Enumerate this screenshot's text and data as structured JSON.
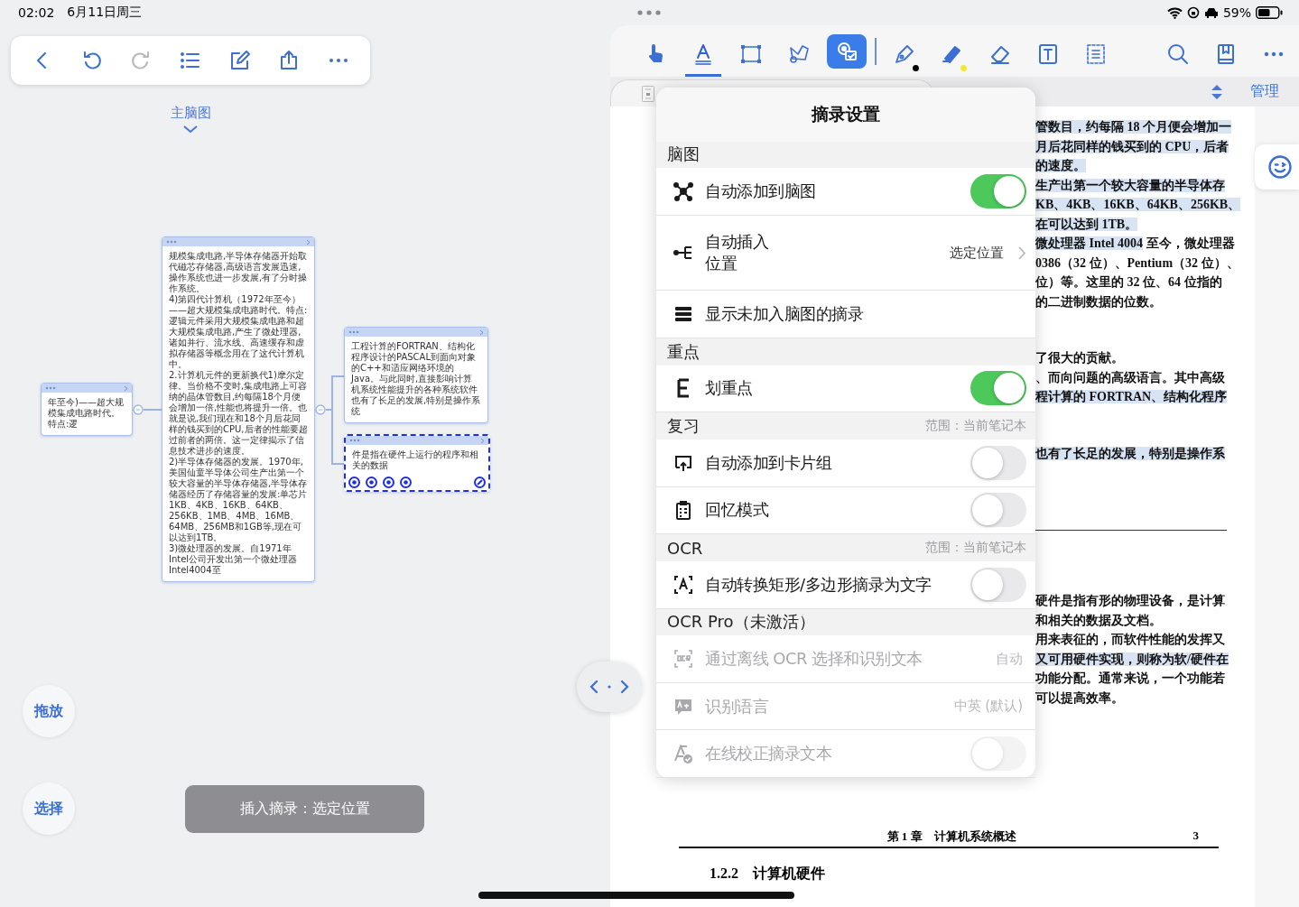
{
  "status_bar": {
    "time": "02:02",
    "date": "6月11日周三",
    "battery": "59%"
  },
  "left_toolbar": [
    {
      "kind": "back",
      "disabled": false
    },
    {
      "kind": "undo",
      "disabled": false
    },
    {
      "kind": "redo",
      "disabled": true
    },
    {
      "kind": "list",
      "disabled": false
    },
    {
      "kind": "edit",
      "disabled": false
    },
    {
      "kind": "share",
      "disabled": false
    },
    {
      "kind": "more",
      "disabled": false
    }
  ],
  "mindmap": {
    "title": "主脑图",
    "root": {
      "text": "年至今)——超大规模集成电路时代。特点:逻",
      "selected": false,
      "children": [
        {
          "text": "规模集成电路,半导体存储器开始取代磁芯存储器,高级语言发展迅速,操作系统也进一步发展,有了分时操作系统。\n4)第四代计算机（1972年至今）——超大规模集成电路时代。特点:逻辑元件采用大规模集成电路和超大规模集成电路,产生了微处理器,诸如并行、流水线、高速缓存和虚拟存储器等概念用在了这代计算机中。\n2.计算机元件的更新换代1)摩尔定律。当价格不变时,集成电路上可容纳的晶体管数目,约每隔18个月便会增加一倍,性能也将提升一倍。也就是说,我们现在和18个月后花同样的钱买到的CPU,后者的性能要超过前者的两倍。这一定律揭示了信息技术进步的速度。\n2)半导体存储器的发展。1970年,美国仙童半导体公司生产出第一个较大容量的半导体存储器,半导体存储器经历了存储容量的发展:单芯片1KB、4KB、16KB、64KB、256KB、1MB、4MB、16MB、64MB、256MB和1GB等,现在可以达到1TB。\n3)微处理器的发展。自1971年Intel公司开发出第一个微处理器Intel4004至",
          "selected": false,
          "children": [
            {
              "text": "工程计算的FORTRAN、结构化程序设计的PASCAL到面向对象的C++和适应网络环境的Java。与此同时,直接影响计算机系统性能提升的各种系统软件也有了长足的发展,特别是操作系统",
              "selected": false
            },
            {
              "text": "件是指在硬件上运行的程序和相关的数据",
              "selected": true
            }
          ]
        }
      ]
    }
  },
  "side_buttons": [
    "拖放",
    "选择"
  ],
  "insert_button": "插入摘录：选定位置",
  "reader_toolbar": [
    {
      "kind": "hand",
      "selected": false,
      "open": false
    },
    {
      "kind": "text",
      "selected": true,
      "open": false
    },
    {
      "kind": "rect",
      "selected": false,
      "open": false
    },
    {
      "kind": "lasso",
      "selected": false,
      "open": false
    },
    {
      "kind": "settings",
      "selected": false,
      "open": true
    },
    {
      "kind": "pen",
      "selected": false,
      "open": false,
      "color": "#000000"
    },
    {
      "kind": "highlighter",
      "selected": false,
      "open": false,
      "color": "#f2e733"
    },
    {
      "kind": "eraser",
      "selected": false,
      "open": false
    },
    {
      "kind": "textbox",
      "selected": false,
      "open": false
    },
    {
      "kind": "outline",
      "selected": false,
      "open": false
    },
    {
      "kind": "search",
      "selected": false,
      "open": false
    },
    {
      "kind": "bookmark",
      "selected": false,
      "open": false
    },
    {
      "kind": "more",
      "selected": false,
      "open": false
    }
  ],
  "tab_row": {
    "manage": "管理"
  },
  "popover": {
    "title": "摘录设置",
    "sections": [
      {
        "title": "脑图",
        "rows": [
          {
            "kind": "toggle",
            "label": "自动添加到脑图",
            "on": true,
            "disabled": false
          },
          {
            "kind": "nav",
            "label": "自动插入位置",
            "value": "选定位置",
            "disabled": false
          },
          {
            "kind": "plain",
            "label": "显示未加入脑图的摘录",
            "disabled": false
          }
        ]
      },
      {
        "title": "重点",
        "rows": [
          {
            "kind": "toggle",
            "label": "划重点",
            "on": true,
            "disabled": false
          }
        ]
      },
      {
        "title": "复习",
        "note": "范围：当前笔记本",
        "rows": [
          {
            "kind": "toggle",
            "label": "自动添加到卡片组",
            "on": false,
            "disabled": false
          },
          {
            "kind": "toggle",
            "label": "回忆模式",
            "on": false,
            "disabled": false
          }
        ]
      },
      {
        "title": "OCR",
        "note": "范围：当前笔记本",
        "rows": [
          {
            "kind": "toggle",
            "label": "自动转换矩形/多边形摘录为文字",
            "on": false,
            "disabled": false
          }
        ]
      },
      {
        "title": "OCR Pro（未激活）",
        "rows": [
          {
            "kind": "value",
            "label": "通过离线 OCR 选择和识别文本",
            "value": "自动",
            "disabled": true
          },
          {
            "kind": "value",
            "label": "识别语言",
            "value": "中英 (默认)",
            "disabled": true
          },
          {
            "kind": "toggle",
            "label": "在线校正摘录文本",
            "on": false,
            "disabled": true
          }
        ]
      }
    ]
  },
  "page": {
    "blocks": [
      {
        "kind": "paragraph",
        "lines": [
          {
            "text": "管数目，约每隔 18 个月便会增加一",
            "highlighted": true
          },
          {
            "text": "月后花同样的钱买到的 CPU，后者",
            "highlighted": true
          },
          {
            "text": "的速度。",
            "highlighted": true
          },
          {
            "text": "生产出第一个较大容量的半导体存",
            "highlighted": true
          },
          {
            "text": "KB、4KB、16KB、64KB、256KB、",
            "highlighted": true
          },
          {
            "text": "在可以达到 1TB。",
            "highlighted": true
          },
          {
            "text": "微处理器 Intel 4004",
            "highlighted": true,
            "rest": " 至今，微处理器"
          },
          {
            "text": "0386（32 位）、Pentium（32 位）、",
            "highlighted": false
          },
          {
            "text": "位）等。这里的 32 位、64 位指的",
            "highlighted": false
          },
          {
            "text": "的二进制数据的位数。",
            "highlighted": false
          }
        ]
      },
      {
        "kind": "paragraph",
        "lines": [
          {
            "text": "了很大的贡献。",
            "highlighted": false
          },
          {
            "text": "、而向问题的高级语言。其中高级",
            "highlighted": false
          },
          {
            "text": "程计算的 FORTRAN、结构化程序",
            "highlighted": true
          }
        ]
      },
      {
        "kind": "paragraph",
        "lines": [
          {
            "text": "也有了长足的发展，特别是操作系",
            "highlighted": true
          }
        ]
      },
      {
        "kind": "rule"
      },
      {
        "kind": "paragraph",
        "lines": [
          {
            "text": "硬件是指有形的物理设备，是计算",
            "highlighted": false
          },
          {
            "text": "和相关的数据及文档。",
            "highlighted": false
          },
          {
            "text": "用来表征的，而软件性能的发挥又",
            "highlighted": false
          },
          {
            "text": "又可用硬件实现，则称为软/硬件在",
            "highlighted": true
          },
          {
            "text": "功能分配。通常来说，一个功能若",
            "highlighted": false
          },
          {
            "text": "可以提高效率。",
            "highlighted": false
          }
        ]
      }
    ],
    "footer": {
      "chapter": "第 1 章　计算机系统概述",
      "page_number": "3"
    },
    "heading": "1.2.2　计算机硬件"
  }
}
